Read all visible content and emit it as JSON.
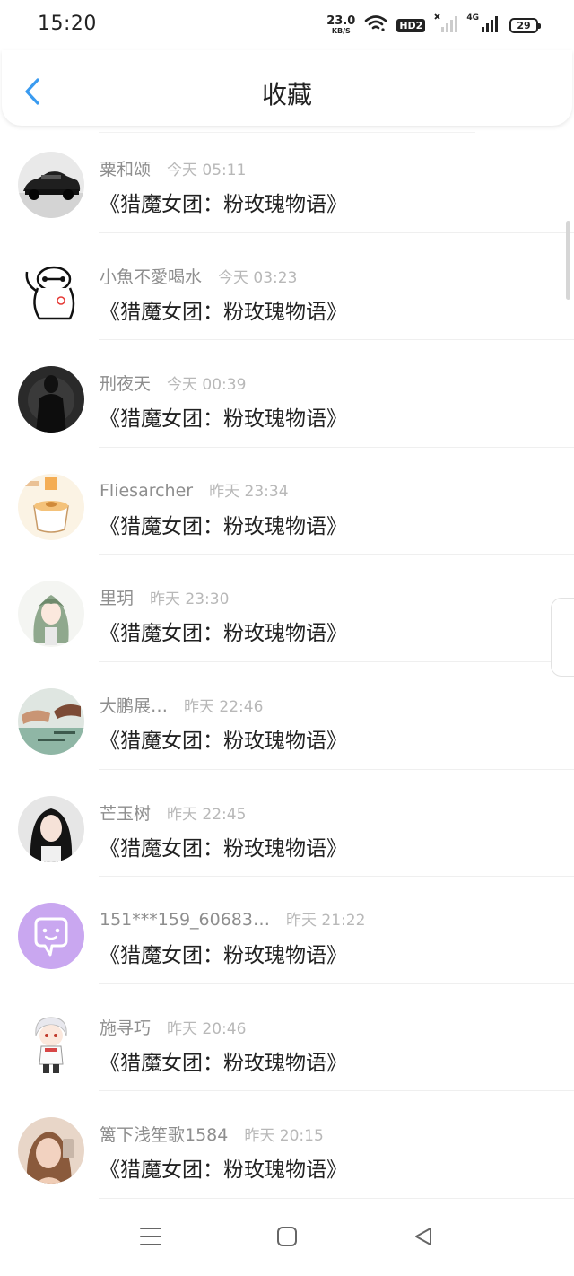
{
  "status_bar": {
    "time": "15:20",
    "net_speed_value": "23.0",
    "net_speed_unit": "KB/S",
    "hd_label": "HD2",
    "signal_label": "4G",
    "battery": "29",
    "icons": [
      "wifi-icon",
      "hd-icon",
      "signal-no-sim-icon",
      "signal-4g-icon",
      "battery-icon"
    ]
  },
  "header": {
    "title": "收藏",
    "back_icon": "chevron-left-icon"
  },
  "items": [
    {
      "username": "粟和颂",
      "time": "今天 05:11",
      "content": "《猎魔女团：粉玫瑰物语》",
      "avatar": "car-avatar"
    },
    {
      "username": "小魚不愛喝水",
      "time": "今天 03:23",
      "content": "《猎魔女团：粉玫瑰物语》",
      "avatar": "robot-avatar"
    },
    {
      "username": "刑夜天",
      "time": "今天 00:39",
      "content": "《猎魔女团：粉玫瑰物语》",
      "avatar": "dark-figure-avatar"
    },
    {
      "username": "Fliesarcher",
      "time": "昨天 23:34",
      "content": "《猎魔女团：粉玫瑰物语》",
      "avatar": "pudding-avatar"
    },
    {
      "username": "里玥",
      "time": "昨天 23:30",
      "content": "《猎魔女团：粉玫瑰物语》",
      "avatar": "anime-girl-avatar"
    },
    {
      "username": "大鹏展…",
      "time": "昨天 22:46",
      "content": "《猎魔女团：粉玫瑰物语》",
      "avatar": "hands-avatar"
    },
    {
      "username": "芒玉树",
      "time": "昨天 22:45",
      "content": "《猎魔女团：粉玫瑰物语》",
      "avatar": "girl-photo-avatar"
    },
    {
      "username": "151***159_60683…",
      "time": "昨天 21:22",
      "content": "《猎魔女团：粉玫瑰物语》",
      "avatar": "chat-bubble-avatar"
    },
    {
      "username": "施寻巧",
      "time": "昨天 20:46",
      "content": "《猎魔女团：粉玫瑰物语》",
      "avatar": "chibi-avatar"
    },
    {
      "username": "篱下浅笙歌1584",
      "time": "昨天 20:15",
      "content": "《猎魔女团：粉玫瑰物语》",
      "avatar": "selfie-avatar"
    }
  ],
  "nav": {
    "icons": [
      "menu-icon",
      "home-icon",
      "back-triangle-icon"
    ]
  },
  "colors": {
    "accent": "#3a9bf0",
    "default_avatar": "#c9a7f0"
  }
}
